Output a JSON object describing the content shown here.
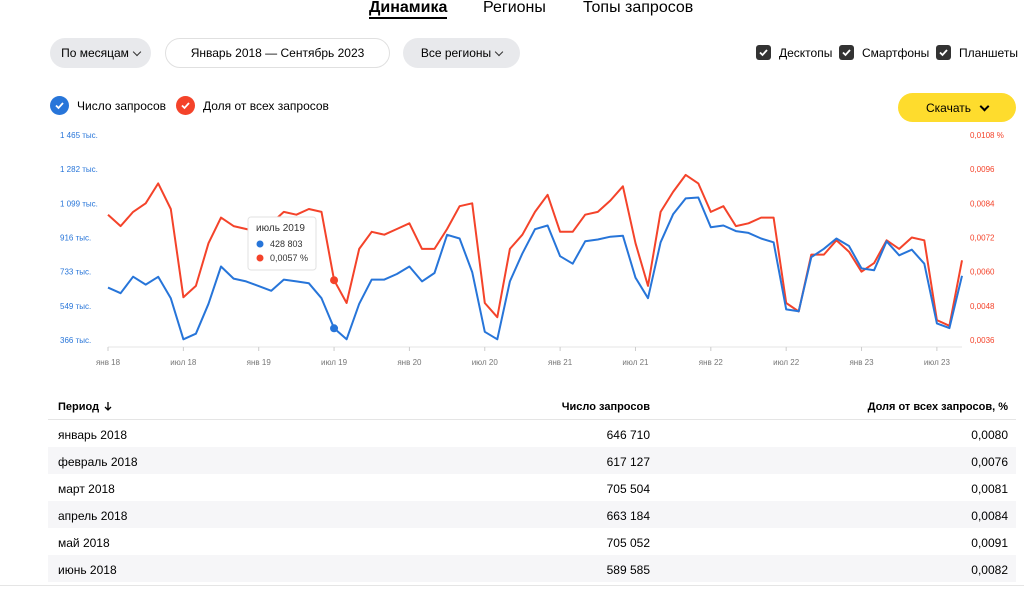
{
  "tabs": [
    "Динамика",
    "Регионы",
    "Топы запросов"
  ],
  "filters": {
    "period": "По месяцам",
    "range": "Январь 2018 — Сентябрь 2023",
    "regions": "Все регионы"
  },
  "devices": [
    "Десктопы",
    "Смартфоны",
    "Планшеты"
  ],
  "legend": {
    "count_label": "Число запросов",
    "share_label": "Доля от всех запросов",
    "count_color": "#2775d9",
    "share_color": "#f4432a"
  },
  "download_label": "Скачать",
  "chart_data": {
    "type": "line",
    "y_left_ticks": [
      "1 465 тыс.",
      "1 282 тыс.",
      "1 099 тыс.",
      "916 тыс.",
      "733 тыс.",
      "549 тыс.",
      "366 тыс."
    ],
    "y_right_ticks": [
      "0,0108 %",
      "0,0096",
      "0,0084",
      "0,0072",
      "0,0060",
      "0,0048",
      "0,0036"
    ],
    "x_ticks": [
      "янв 18",
      "июл 18",
      "янв 19",
      "июл 19",
      "янв 20",
      "июл 20",
      "янв 21",
      "июл 21",
      "янв 22",
      "июл 22",
      "янв 23",
      "июл 23"
    ],
    "y_left_range": [
      366,
      1465
    ],
    "y_right_range": [
      0.0036,
      0.0108
    ],
    "series": [
      {
        "name": "Число запросов",
        "color": "#2775d9",
        "values": [
          646710,
          617127,
          705504,
          663184,
          705052,
          589585,
          370000,
          400000,
          560000,
          760000,
          695000,
          680000,
          655000,
          630000,
          690000,
          680000,
          670000,
          590000,
          428803,
          370000,
          560000,
          690000,
          690000,
          720000,
          760000,
          680000,
          725000,
          930000,
          910000,
          730000,
          410000,
          370000,
          680000,
          830000,
          960000,
          980000,
          815000,
          775000,
          895000,
          905000,
          920000,
          925000,
          700000,
          590000,
          890000,
          1040000,
          1125000,
          1130000,
          970000,
          980000,
          950000,
          940000,
          910000,
          890000,
          530000,
          520000,
          810000,
          855000,
          910000,
          870000,
          750000,
          740000,
          895000,
          820000,
          850000,
          775000,
          455000,
          430000,
          710000
        ]
      },
      {
        "name": "Доля от всех запросов",
        "color": "#f4432a",
        "values": [
          0.008,
          0.0076,
          0.0081,
          0.0084,
          0.0091,
          0.0082,
          0.0051,
          0.0055,
          0.007,
          0.0079,
          0.0076,
          0.0075,
          0.0074,
          0.0077,
          0.0081,
          0.008,
          0.0082,
          0.0081,
          0.0057,
          0.0049,
          0.0068,
          0.0074,
          0.0073,
          0.0075,
          0.0077,
          0.0068,
          0.0068,
          0.0075,
          0.0083,
          0.0084,
          0.0049,
          0.0044,
          0.0068,
          0.0073,
          0.0081,
          0.0087,
          0.0074,
          0.0074,
          0.008,
          0.0081,
          0.0085,
          0.009,
          0.007,
          0.0055,
          0.0081,
          0.0088,
          0.0094,
          0.0091,
          0.0081,
          0.0083,
          0.0076,
          0.0077,
          0.0079,
          0.0079,
          0.0049,
          0.0046,
          0.0066,
          0.0066,
          0.0071,
          0.0067,
          0.006,
          0.0063,
          0.0071,
          0.0068,
          0.0072,
          0.0071,
          0.0043,
          0.0041,
          0.0064
        ]
      }
    ],
    "tooltip": {
      "title": "июль 2019",
      "count": "428 803",
      "share": "0,0057 %",
      "index": 18
    }
  },
  "table": {
    "headers": [
      "Период",
      "Число запросов",
      "Доля от всех запросов, %"
    ],
    "sort_icon": "arrow-down-icon",
    "rows": [
      [
        "январь 2018",
        "646 710",
        "0,0080"
      ],
      [
        "февраль 2018",
        "617 127",
        "0,0076"
      ],
      [
        "март 2018",
        "705 504",
        "0,0081"
      ],
      [
        "апрель 2018",
        "663 184",
        "0,0084"
      ],
      [
        "май 2018",
        "705 052",
        "0,0091"
      ],
      [
        "июнь 2018",
        "589 585",
        "0,0082"
      ]
    ]
  }
}
